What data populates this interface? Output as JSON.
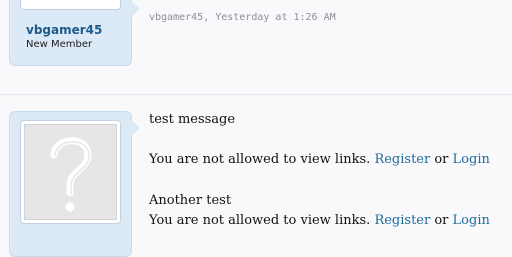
{
  "posts": [
    {
      "username": "vbgamer45",
      "user_title": "New Member",
      "meta": "vbgamer45, Yesterday at 1:26 AM"
    },
    {
      "message_title": "test message",
      "blocks": [
        {
          "prefix": "You are not allowed to view links.",
          "register": "Register",
          "or": "or",
          "login": "Login"
        },
        {
          "heading": "Another test",
          "prefix": "You are not allowed to view links.",
          "register": "Register",
          "or": "or",
          "login": "Login"
        }
      ],
      "avatar_icon": "question-mark-icon"
    }
  ],
  "colors": {
    "card_bg": "#dce9f7",
    "link": "#1f6b9a",
    "username": "#1f5a87"
  }
}
